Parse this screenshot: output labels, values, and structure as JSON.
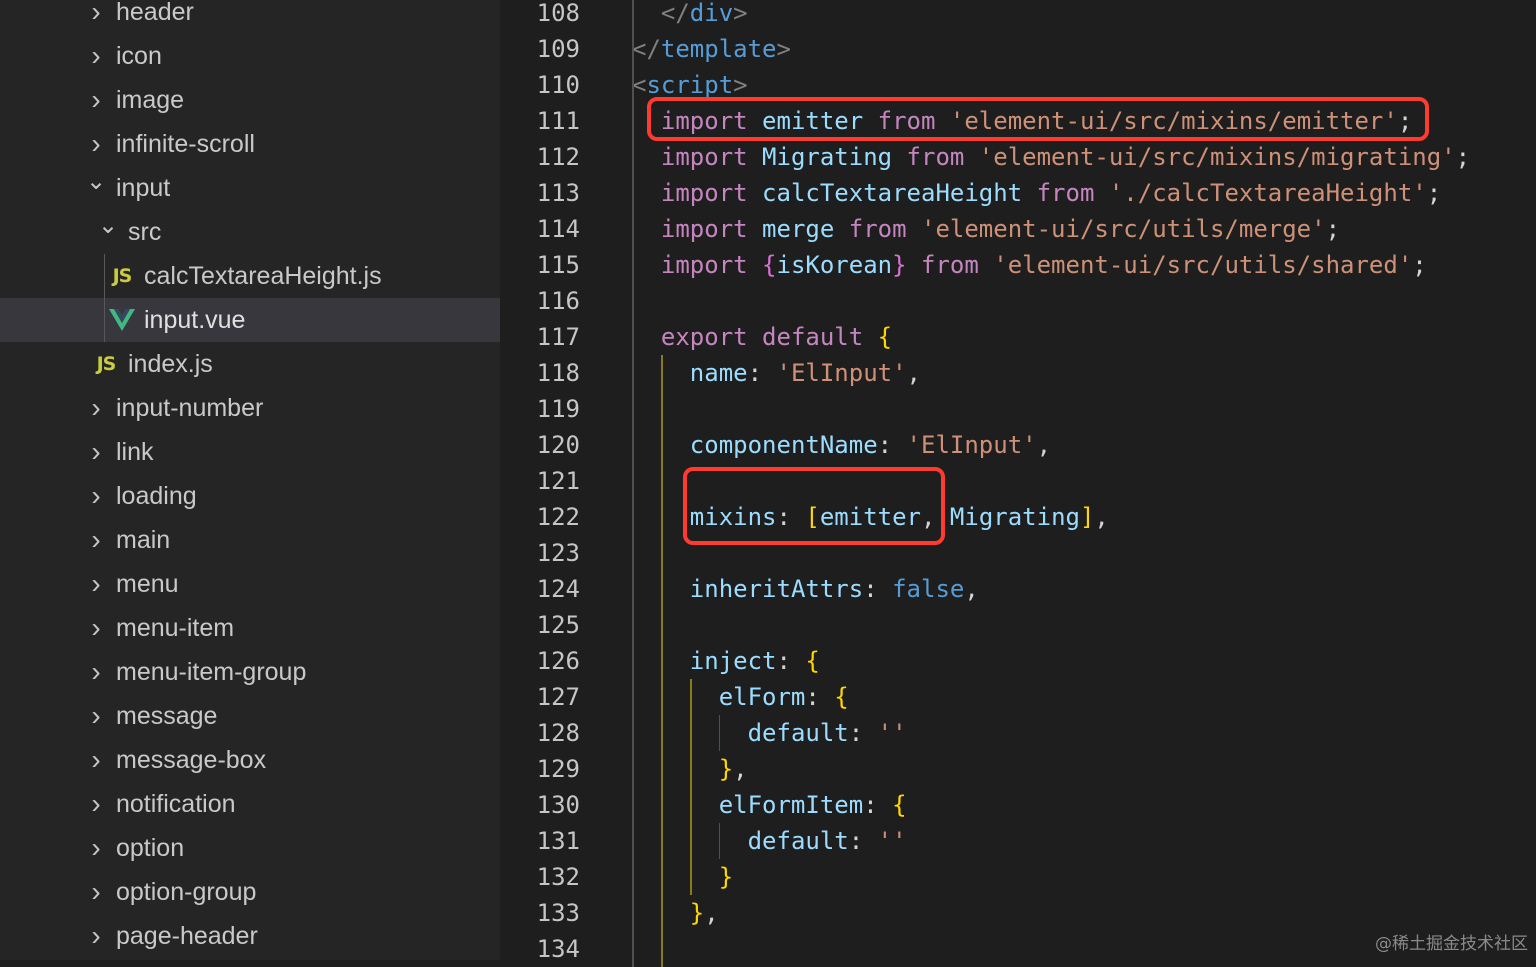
{
  "explorer": {
    "items": [
      {
        "label": "header",
        "kind": "folder-closed",
        "depth": 0
      },
      {
        "label": "icon",
        "kind": "folder-closed",
        "depth": 0
      },
      {
        "label": "image",
        "kind": "folder-closed",
        "depth": 0
      },
      {
        "label": "infinite-scroll",
        "kind": "folder-closed",
        "depth": 0
      },
      {
        "label": "input",
        "kind": "folder-open",
        "depth": 0
      },
      {
        "label": "src",
        "kind": "folder-open",
        "depth": 1
      },
      {
        "label": "calcTextareaHeight.js",
        "kind": "js-file",
        "depth": 2
      },
      {
        "label": "input.vue",
        "kind": "vue-file",
        "depth": 2,
        "selected": true
      },
      {
        "label": "index.js",
        "kind": "js-file",
        "depth": 1
      },
      {
        "label": "input-number",
        "kind": "folder-closed",
        "depth": 0
      },
      {
        "label": "link",
        "kind": "folder-closed",
        "depth": 0
      },
      {
        "label": "loading",
        "kind": "folder-closed",
        "depth": 0
      },
      {
        "label": "main",
        "kind": "folder-closed",
        "depth": 0
      },
      {
        "label": "menu",
        "kind": "folder-closed",
        "depth": 0
      },
      {
        "label": "menu-item",
        "kind": "folder-closed",
        "depth": 0
      },
      {
        "label": "menu-item-group",
        "kind": "folder-closed",
        "depth": 0
      },
      {
        "label": "message",
        "kind": "folder-closed",
        "depth": 0
      },
      {
        "label": "message-box",
        "kind": "folder-closed",
        "depth": 0
      },
      {
        "label": "notification",
        "kind": "folder-closed",
        "depth": 0
      },
      {
        "label": "option",
        "kind": "folder-closed",
        "depth": 0
      },
      {
        "label": "option-group",
        "kind": "folder-closed",
        "depth": 0
      },
      {
        "label": "page-header",
        "kind": "folder-closed",
        "depth": 0
      }
    ],
    "icons": {
      "js": "JS",
      "vue": "vue-icon"
    }
  },
  "editor": {
    "lines": [
      {
        "n": "108",
        "indent": 1,
        "tokens": [
          [
            "</",
            "punc"
          ],
          [
            "div",
            "tag"
          ],
          [
            ">",
            "punc"
          ]
        ]
      },
      {
        "n": "109",
        "indent": 0,
        "tokens": [
          [
            "</",
            "punc"
          ],
          [
            "template",
            "tag"
          ],
          [
            ">",
            "punc"
          ]
        ]
      },
      {
        "n": "110",
        "indent": 0,
        "tokens": [
          [
            "<",
            "punc"
          ],
          [
            "script",
            "tag"
          ],
          [
            ">",
            "punc"
          ]
        ]
      },
      {
        "n": "111",
        "indent": 1,
        "tokens": [
          [
            "import",
            "kw"
          ],
          [
            " ",
            "plain"
          ],
          [
            "emitter",
            "var"
          ],
          [
            " ",
            "plain"
          ],
          [
            "from",
            "kw"
          ],
          [
            " ",
            "plain"
          ],
          [
            "'element-ui/src/mixins/emitter'",
            "str"
          ],
          [
            ";",
            "plain"
          ]
        ]
      },
      {
        "n": "112",
        "indent": 1,
        "tokens": [
          [
            "import",
            "kw"
          ],
          [
            " ",
            "plain"
          ],
          [
            "Migrating",
            "var"
          ],
          [
            " ",
            "plain"
          ],
          [
            "from",
            "kw"
          ],
          [
            " ",
            "plain"
          ],
          [
            "'element-ui/src/mixins/migrating'",
            "str"
          ],
          [
            ";",
            "plain"
          ]
        ]
      },
      {
        "n": "113",
        "indent": 1,
        "tokens": [
          [
            "import",
            "kw"
          ],
          [
            " ",
            "plain"
          ],
          [
            "calcTextareaHeight",
            "var"
          ],
          [
            " ",
            "plain"
          ],
          [
            "from",
            "kw"
          ],
          [
            " ",
            "plain"
          ],
          [
            "'./calcTextareaHeight'",
            "str"
          ],
          [
            ";",
            "plain"
          ]
        ]
      },
      {
        "n": "114",
        "indent": 1,
        "tokens": [
          [
            "import",
            "kw"
          ],
          [
            " ",
            "plain"
          ],
          [
            "merge",
            "var"
          ],
          [
            " ",
            "plain"
          ],
          [
            "from",
            "kw"
          ],
          [
            " ",
            "plain"
          ],
          [
            "'element-ui/src/utils/merge'",
            "str"
          ],
          [
            ";",
            "plain"
          ]
        ]
      },
      {
        "n": "115",
        "indent": 1,
        "tokens": [
          [
            "import",
            "kw"
          ],
          [
            " ",
            "plain"
          ],
          [
            "{",
            "br2"
          ],
          [
            "isKorean",
            "var"
          ],
          [
            "}",
            "br2"
          ],
          [
            " ",
            "plain"
          ],
          [
            "from",
            "kw"
          ],
          [
            " ",
            "plain"
          ],
          [
            "'element-ui/src/utils/shared'",
            "str"
          ],
          [
            ";",
            "plain"
          ]
        ]
      },
      {
        "n": "116",
        "indent": 0,
        "tokens": []
      },
      {
        "n": "117",
        "indent": 1,
        "tokens": [
          [
            "export",
            "kw"
          ],
          [
            " ",
            "plain"
          ],
          [
            "default",
            "kw"
          ],
          [
            " ",
            "plain"
          ],
          [
            "{",
            "br1"
          ]
        ]
      },
      {
        "n": "118",
        "indent": 2,
        "tokens": [
          [
            "name",
            "var"
          ],
          [
            ": ",
            "plain"
          ],
          [
            "'ElInput'",
            "str"
          ],
          [
            ",",
            "plain"
          ]
        ]
      },
      {
        "n": "119",
        "indent": 0,
        "tokens": []
      },
      {
        "n": "120",
        "indent": 2,
        "tokens": [
          [
            "componentName",
            "var"
          ],
          [
            ": ",
            "plain"
          ],
          [
            "'ElInput'",
            "str"
          ],
          [
            ",",
            "plain"
          ]
        ]
      },
      {
        "n": "121",
        "indent": 0,
        "tokens": []
      },
      {
        "n": "122",
        "indent": 2,
        "tokens": [
          [
            "mixins",
            "var"
          ],
          [
            ": ",
            "plain"
          ],
          [
            "[",
            "br1"
          ],
          [
            "emitter",
            "var"
          ],
          [
            ", ",
            "plain"
          ],
          [
            "Migrating",
            "var"
          ],
          [
            "]",
            "br1"
          ],
          [
            ",",
            "plain"
          ]
        ]
      },
      {
        "n": "123",
        "indent": 0,
        "tokens": []
      },
      {
        "n": "124",
        "indent": 2,
        "tokens": [
          [
            "inheritAttrs",
            "var"
          ],
          [
            ": ",
            "plain"
          ],
          [
            "false",
            "bool"
          ],
          [
            ",",
            "plain"
          ]
        ]
      },
      {
        "n": "125",
        "indent": 0,
        "tokens": []
      },
      {
        "n": "126",
        "indent": 2,
        "tokens": [
          [
            "inject",
            "var"
          ],
          [
            ": ",
            "plain"
          ],
          [
            "{",
            "br1"
          ]
        ]
      },
      {
        "n": "127",
        "indent": 3,
        "tokens": [
          [
            "elForm",
            "var"
          ],
          [
            ": ",
            "plain"
          ],
          [
            "{",
            "br1"
          ]
        ]
      },
      {
        "n": "128",
        "indent": 4,
        "tokens": [
          [
            "default",
            "var"
          ],
          [
            ": ",
            "plain"
          ],
          [
            "''",
            "str"
          ]
        ]
      },
      {
        "n": "129",
        "indent": 3,
        "tokens": [
          [
            "}",
            "br1"
          ],
          [
            ",",
            "plain"
          ]
        ]
      },
      {
        "n": "130",
        "indent": 3,
        "tokens": [
          [
            "elFormItem",
            "var"
          ],
          [
            ": ",
            "plain"
          ],
          [
            "{",
            "br1"
          ]
        ]
      },
      {
        "n": "131",
        "indent": 4,
        "tokens": [
          [
            "default",
            "var"
          ],
          [
            ": ",
            "plain"
          ],
          [
            "''",
            "str"
          ]
        ]
      },
      {
        "n": "132",
        "indent": 3,
        "tokens": [
          [
            "}",
            "br1"
          ]
        ]
      },
      {
        "n": "133",
        "indent": 2,
        "tokens": [
          [
            "}",
            "br1"
          ],
          [
            ",",
            "plain"
          ]
        ]
      },
      {
        "n": "134",
        "indent": 0,
        "tokens": []
      }
    ]
  },
  "highlights": [
    {
      "label": "import-emitter-highlight",
      "line": "111"
    },
    {
      "label": "mixins-highlight",
      "line": "122"
    }
  ],
  "colors": {
    "highlight_border": "#ff3b30",
    "sidebar_bg": "#252526",
    "editor_bg": "#1e1e1e",
    "selected_row": "#37373d"
  },
  "watermark": "@稀土掘金技术社区"
}
